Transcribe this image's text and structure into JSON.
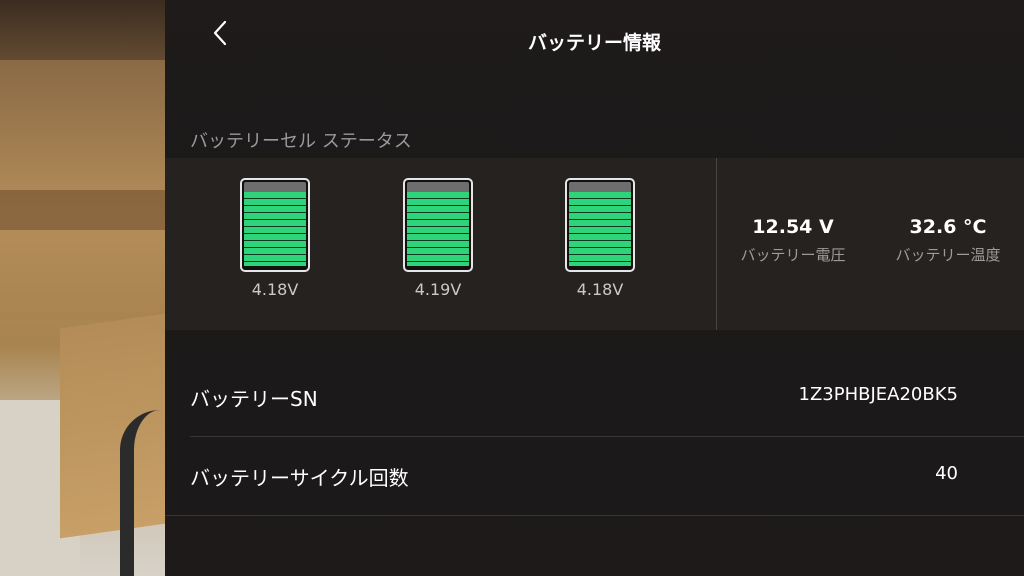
{
  "header": {
    "title": "バッテリー情報"
  },
  "icons": {
    "back": "chevron-left-icon"
  },
  "cells_section": {
    "label": "バッテリーセル ステータス",
    "cells": [
      {
        "voltage": "4.18V",
        "level": 1.0
      },
      {
        "voltage": "4.19V",
        "level": 1.0
      },
      {
        "voltage": "4.18V",
        "level": 1.0
      }
    ],
    "battery_voltage": {
      "value": "12.54 V",
      "label": "バッテリー電圧"
    },
    "battery_temperature": {
      "value": "32.6 °C",
      "label": "バッテリー温度"
    }
  },
  "info_rows": [
    {
      "label": "バッテリーSN",
      "value": "1Z3PHBJEA20BK5"
    },
    {
      "label": "バッテリーサイクル回数",
      "value": "40"
    }
  ],
  "colors": {
    "cell_fill": "#2fd47a",
    "panel_bg": "#1b1919",
    "label_gray": "#9a9a9a"
  }
}
